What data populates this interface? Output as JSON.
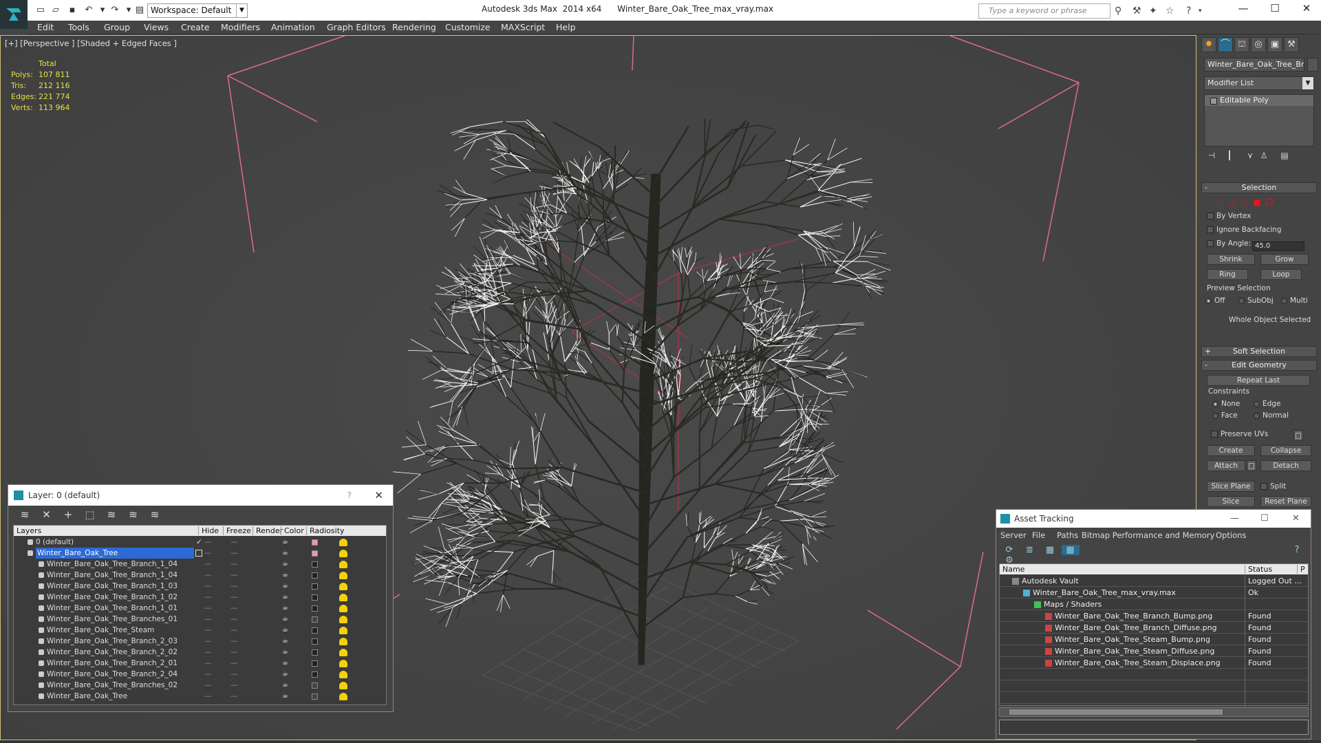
{
  "titlebar": {
    "workspace": "Workspace: Default",
    "app_title": "Autodesk 3ds Max  2014 x64      Winter_Bare_Oak_Tree_max_vray.max",
    "search_placeholder": "Type a keyword or phrase"
  },
  "menu": [
    "Edit",
    "Tools",
    "Group",
    "Views",
    "Create",
    "Modifiers",
    "Animation",
    "Graph Editors",
    "Rendering",
    "Customize",
    "MAXScript",
    "Help"
  ],
  "viewport": {
    "label": "[+] [Perspective ] [Shaded + Edged Faces ]",
    "stats_header": "Total",
    "stats": [
      {
        "k": "Polys:",
        "v": "107 811"
      },
      {
        "k": "Tris:",
        "v": "212 116"
      },
      {
        "k": "Edges:",
        "v": "221 774"
      },
      {
        "k": "Verts:",
        "v": "113 964"
      }
    ]
  },
  "command_panel": {
    "object_name": "Winter_Bare_Oak_Tree_Bran",
    "modifier_list": "Modifier List",
    "stack_item": "Editable Poly",
    "selection": {
      "title": "Selection",
      "by_vertex": "By Vertex",
      "ignore_backfacing": "Ignore Backfacing",
      "by_angle": "By Angle:",
      "angle_value": "45.0",
      "shrink": "Shrink",
      "grow": "Grow",
      "ring": "Ring",
      "loop": "Loop",
      "preview_title": "Preview Selection",
      "preview_off": "Off",
      "preview_subobj": "SubObj",
      "preview_multi": "Multi",
      "status": "Whole Object Selected"
    },
    "soft_selection": "Soft Selection",
    "edit_geometry": {
      "title": "Edit Geometry",
      "repeat_last": "Repeat Last",
      "constraints": "Constraints",
      "none": "None",
      "edge": "Edge",
      "face": "Face",
      "normal": "Normal",
      "preserve_uvs": "Preserve UVs",
      "create": "Create",
      "collapse": "Collapse",
      "attach": "Attach",
      "detach": "Detach",
      "slice_plane": "Slice Plane",
      "split": "Split",
      "slice": "Slice",
      "reset_plane": "Reset Plane"
    }
  },
  "layer_dialog": {
    "title": "Layer: 0 (default)",
    "help": "?",
    "columns": [
      "Layers",
      "Hide",
      "Freeze",
      "Render",
      "Color",
      "Radiosity"
    ],
    "rows": [
      {
        "name": "0 (default)",
        "color": "#e89ab0"
      },
      {
        "name": "Winter_Bare_Oak_Tree",
        "color": "#e89ab0"
      },
      {
        "name": "Winter_Bare_Oak_Tree_Branch_1_04",
        "color": "#222222"
      },
      {
        "name": "Winter_Bare_Oak_Tree_Branch_1_04",
        "color": "#222222"
      },
      {
        "name": "Winter_Bare_Oak_Tree_Branch_1_03",
        "color": "#222222"
      },
      {
        "name": "Winter_Bare_Oak_Tree_Branch_1_02",
        "color": "#222222"
      },
      {
        "name": "Winter_Bare_Oak_Tree_Branch_1_01",
        "color": "#222222"
      },
      {
        "name": "Winter_Bare_Oak_Tree_Branches_01",
        "color": "#444444"
      },
      {
        "name": "Winter_Bare_Oak_Tree_Steam",
        "color": "#222222"
      },
      {
        "name": "Winter_Bare_Oak_Tree_Branch_2_03",
        "color": "#222222"
      },
      {
        "name": "Winter_Bare_Oak_Tree_Branch_2_02",
        "color": "#222222"
      },
      {
        "name": "Winter_Bare_Oak_Tree_Branch_2_01",
        "color": "#222222"
      },
      {
        "name": "Winter_Bare_Oak_Tree_Branch_2_04",
        "color": "#222222"
      },
      {
        "name": "Winter_Bare_Oak_Tree_Branches_02",
        "color": "#444444"
      },
      {
        "name": "Winter_Bare_Oak_Tree",
        "color": "#444444"
      }
    ]
  },
  "asset_dialog": {
    "title": "Asset Tracking",
    "menu": [
      "Server",
      "File",
      "Paths",
      "Bitmap Performance and Memory",
      "Options"
    ],
    "columns": [
      "Name",
      "Status",
      "P"
    ],
    "rows": [
      {
        "name": "Autodesk Vault",
        "status": "Logged Out ...",
        "level": 0
      },
      {
        "name": "Winter_Bare_Oak_Tree_max_vray.max",
        "status": "Ok",
        "level": 1
      },
      {
        "name": "Maps / Shaders",
        "status": "",
        "level": 2
      },
      {
        "name": "Winter_Bare_Oak_Tree_Branch_Bump.png",
        "status": "Found",
        "level": 3
      },
      {
        "name": "Winter_Bare_Oak_Tree_Branch_Diffuse.png",
        "status": "Found",
        "level": 3
      },
      {
        "name": "Winter_Bare_Oak_Tree_Steam_Bump.png",
        "status": "Found",
        "level": 3
      },
      {
        "name": "Winter_Bare_Oak_Tree_Steam_Diffuse.png",
        "status": "Found",
        "level": 3
      },
      {
        "name": "Winter_Bare_Oak_Tree_Steam_Displace.png",
        "status": "Found",
        "level": 3
      }
    ]
  }
}
